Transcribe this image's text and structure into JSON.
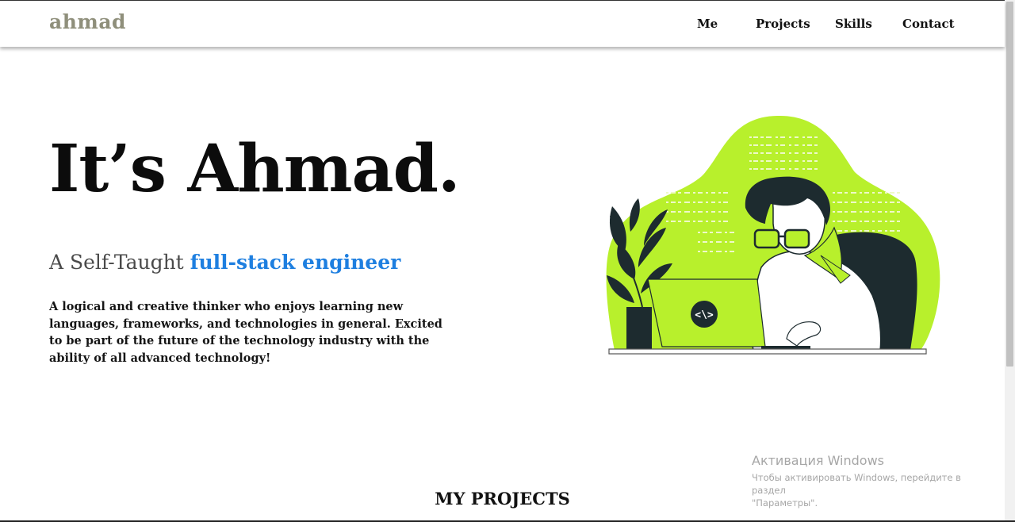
{
  "header": {
    "logo": "ahmad",
    "nav": [
      {
        "label": "Me"
      },
      {
        "label": "Projects"
      },
      {
        "label": "Skills"
      },
      {
        "label": "Contact"
      }
    ]
  },
  "hero": {
    "title": "It’s Ahmad.",
    "subtitle_prefix": "A Self-Taught ",
    "subtitle_highlight": "full-stack engineer",
    "description": "A logical and creative thinker who enjoys learning new languages, frameworks, and technologies in general. Excited to be part of the future of the technology industry with the ability of all advanced technology!",
    "illustration": "developer-at-laptop-illustration",
    "laptop_code_symbol": "<\\>"
  },
  "windows_activation": {
    "title": "Активация Windows",
    "line1": "Чтобы активировать Windows, перейдите в раздел",
    "line2": "\"Параметры\"."
  },
  "projects_section": {
    "title": "MY PROJECTS"
  },
  "colors": {
    "accent_blue": "#1e7fe0",
    "lime": "#b8f02c",
    "logo_gray": "#8f8f7b",
    "dark": "#1d2b2f"
  }
}
